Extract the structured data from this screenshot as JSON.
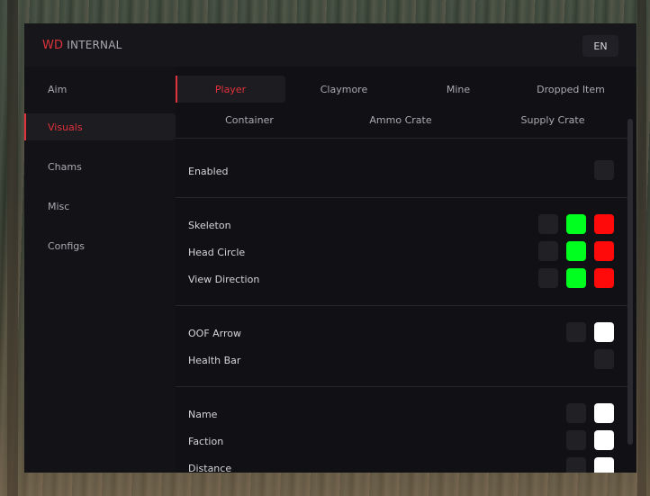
{
  "brand": {
    "prefix": "WD",
    "suffix": "INTERNAL"
  },
  "language": "EN",
  "sidebar": {
    "items": [
      {
        "label": "Aim",
        "active": false
      },
      {
        "label": "Visuals",
        "active": true
      },
      {
        "label": "Chams",
        "active": false
      },
      {
        "label": "Misc",
        "active": false
      },
      {
        "label": "Configs",
        "active": false
      }
    ]
  },
  "tabs": {
    "row1": [
      {
        "label": "Player",
        "active": true
      },
      {
        "label": "Claymore",
        "active": false
      },
      {
        "label": "Mine",
        "active": false
      },
      {
        "label": "Dropped Item",
        "active": false
      }
    ],
    "row2": [
      {
        "label": "Container",
        "active": false
      },
      {
        "label": "Ammo Crate",
        "active": false
      },
      {
        "label": "Supply Crate",
        "active": false
      }
    ]
  },
  "options": {
    "enabled": {
      "label": "Enabled",
      "checked": false
    },
    "skeleton": {
      "label": "Skeleton",
      "checked": false,
      "colors": [
        "#00ff1e",
        "#ff0a0a"
      ]
    },
    "head_circle": {
      "label": "Head Circle",
      "checked": false,
      "colors": [
        "#00ff1e",
        "#ff0a0a"
      ]
    },
    "view_direction": {
      "label": "View Direction",
      "checked": false,
      "colors": [
        "#00ff1e",
        "#ff0a0a"
      ]
    },
    "oof_arrow": {
      "label": "OOF Arrow",
      "checked": false,
      "colors": [
        "#ffffff"
      ]
    },
    "health_bar": {
      "label": "Health Bar",
      "checked": false
    },
    "name": {
      "label": "Name",
      "checked": false,
      "colors": [
        "#ffffff"
      ]
    },
    "faction": {
      "label": "Faction",
      "checked": false,
      "colors": [
        "#ffffff"
      ]
    },
    "distance": {
      "label": "Distance",
      "checked": false,
      "colors": [
        "#ffffff"
      ]
    }
  },
  "theme": {
    "accent": "#e0323c",
    "panel": "#111115",
    "control": "#202025"
  }
}
